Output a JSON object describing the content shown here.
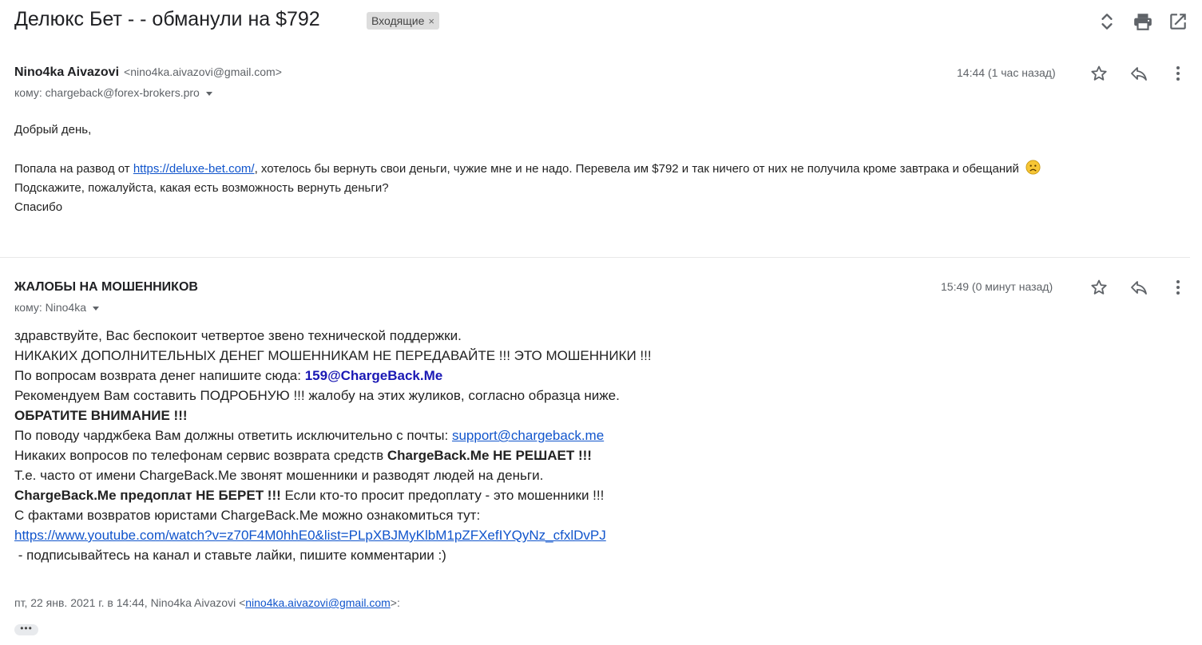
{
  "header": {
    "subject": "Делюкс Бет - - обманули на $792",
    "label": "Входящие",
    "label_close": "×"
  },
  "message1": {
    "sender_name": "Nino4ka Aivazovi",
    "sender_email": "<nino4ka.aivazovi@gmail.com>",
    "to_line": "кому: chargeback@forex-brokers.pro",
    "time": "14:44 (1 час назад)",
    "greeting": "Добрый день,",
    "line1_pre": "Попала на развод от ",
    "line1_link": "https://deluxe-bet.com/",
    "line1_post": ", хотелось бы вернуть свои деньги, чужие мне и не надо. Перевела им $792 и так ничего от них не получила кроме завтрака и обещаний",
    "line2": "Подскажите, пожалуйста, какая есть возможность вернуть деньги?",
    "line3": "Спасибо"
  },
  "message2": {
    "sender_name": "ЖАЛОБЫ НА МОШЕННИКОВ",
    "to_line": "кому: Nino4ka",
    "time": "15:49 (0 минут назад)",
    "l1": "здравствуйте, Вас беспокоит четвертое звено технической поддержки.",
    "l2": "НИКАКИХ ДОПОЛНИТЕЛЬНЫХ ДЕНЕГ МОШЕННИКАМ НЕ ПЕРЕДАВАЙТЕ !!! ЭТО МОШЕННИКИ !!!",
    "l3_pre": "По вопросам возврата денег напишите сюда: ",
    "l3_email": "159@ChargeBack.Me",
    "l4": "Рекомендуем Вам составить ПОДРОБНУЮ !!! жалобу на этих жуликов, согласно образца ниже.",
    "l5": "ОБРАТИТЕ ВНИМАНИЕ !!!",
    "l6_pre": "По поводу чарджбека Вам должны ответить исключительно с почты: ",
    "l6_link": "support@chargeback.me",
    "l7_pre": "Никаких вопросов по телефонам сервис возврата средств ",
    "l7_bold": "ChargeBack.Me НЕ РЕШАЕТ !!!",
    "l8": "Т.е. часто от имени ChargeBack.Me звонят мошенники и разводят людей на деньги.",
    "l9_bold": "ChargeBack.Me предоплат НЕ БЕРЕТ !!!",
    "l9_post": " Если кто-то просит предоплату - это мошенники !!!",
    "l10": "С фактами возвратов юристами ChargeBack.Me можно ознакомиться тут:",
    "l11_link": "https://www.youtube.com/watch?v=z70F4M0hhE0&list=PLpXBJMyKlbM1pZFXefIYQyNz_cfxlDvPJ",
    "l12": " - подписывайтесь на канал и ставьте лайки, пишите комментарии :)",
    "quote_pre": "пт, 22 янв. 2021 г. в 14:44, Nino4ka Aivazovi <",
    "quote_email": "nino4ka.aivazovi@gmail.com",
    "quote_post": ">:",
    "ellipsis": "•••"
  },
  "icons": {
    "expand": "expand-collapse-icon",
    "print": "print-icon",
    "new_window": "open-in-new-window-icon",
    "star": "star-icon",
    "reply": "reply-icon",
    "more": "more-vertical-icon",
    "emoji": "sad-face-emoji"
  }
}
